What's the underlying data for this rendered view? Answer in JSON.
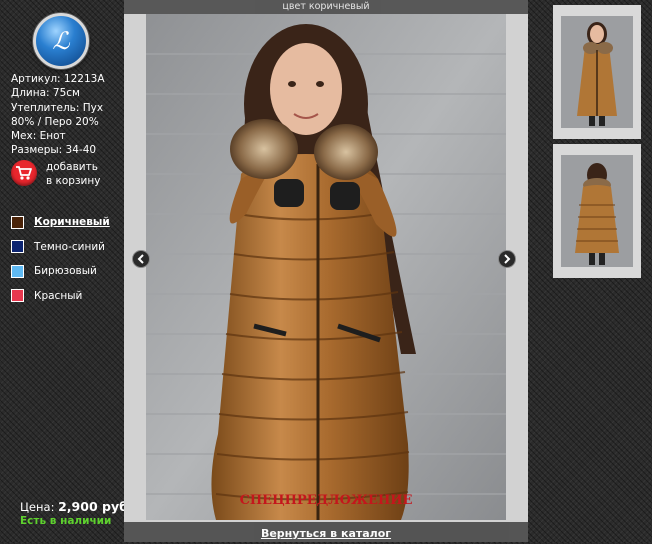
{
  "logo": {
    "glyph": "ℒ"
  },
  "product": {
    "specs": [
      "Артикул: 12213A",
      "Длина: 75см",
      "Утеплитель: Пух 80% / Перо 20%",
      "Мех: Енот",
      "Размеры: 34-40"
    ],
    "cart_label": "добавить в корзину",
    "price_label": "Цена:",
    "price_value": "2,900 руб.",
    "stock": "Есть в наличии"
  },
  "colors": [
    {
      "name": "Коричневый",
      "hex": "#4a2309",
      "active": true
    },
    {
      "name": "Темно-синий",
      "hex": "#0c2470",
      "active": false
    },
    {
      "name": "Бирюзовый",
      "hex": "#5fb9f2",
      "active": false
    },
    {
      "name": "Красный",
      "hex": "#e8384f",
      "active": false
    }
  ],
  "viewer": {
    "caption": "цвет коричневый",
    "special_offer": "СПЕЦПРЕДЛОЖЕНИЕ",
    "back_link": "Вернуться в каталог",
    "prev_icon": "arrow-left-icon",
    "next_icon": "arrow-right-icon"
  },
  "thumbnails": [
    {
      "label": "front view"
    },
    {
      "label": "back view"
    }
  ],
  "accent": {
    "cart": "#e8262d",
    "stock": "#5ed12e",
    "special": "#c4161c"
  }
}
